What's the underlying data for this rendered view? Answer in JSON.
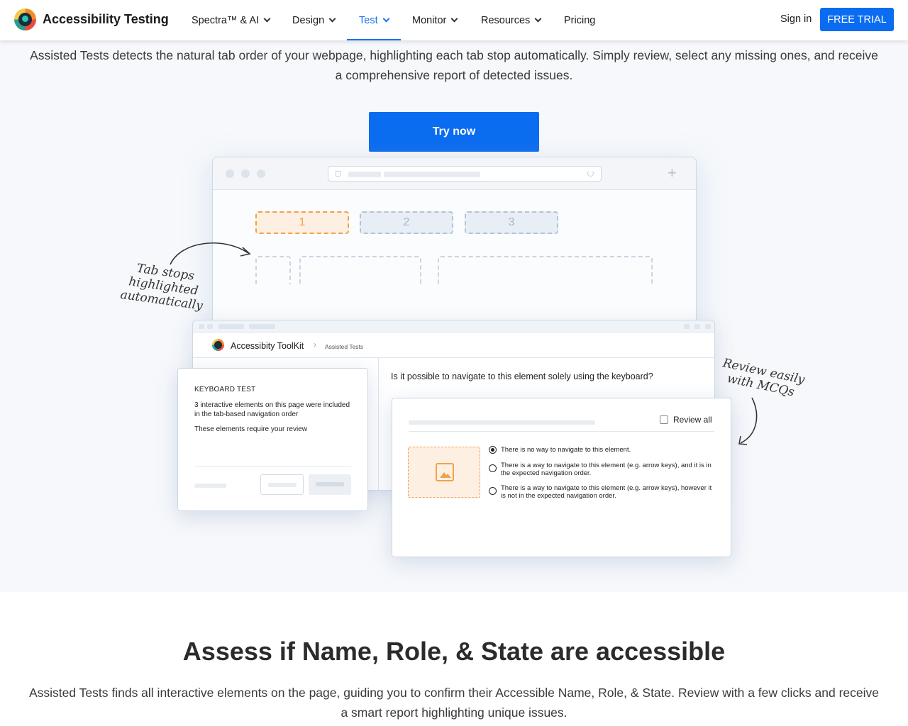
{
  "header": {
    "brand": "Accessibility Testing",
    "nav": [
      {
        "label": "Spectra™ & AI",
        "has_menu": true
      },
      {
        "label": "Design",
        "has_menu": true
      },
      {
        "label": "Test",
        "has_menu": true,
        "active": true
      },
      {
        "label": "Monitor",
        "has_menu": true
      },
      {
        "label": "Resources",
        "has_menu": true
      },
      {
        "label": "Pricing",
        "has_menu": false
      }
    ],
    "signin": "Sign in",
    "cta": "FREE TRIAL"
  },
  "hero": {
    "description": "Assisted Tests detects the natural tab order of your webpage, highlighting each tab stop automatically. Simply review, select any missing ones, and receive a comprehensive report of detected issues.",
    "button": "Try now"
  },
  "illustration": {
    "tab_stops": [
      "1",
      "2",
      "3"
    ],
    "note_left": "Tab stops highlighted automatically",
    "note_right": "Review easily with MCQs",
    "toolkit": {
      "name": "Accessibity ToolKit",
      "breadcrumb": "Assisted Tests",
      "question": "Is it possible to navigate to this element solely using the keyboard?"
    },
    "keyboard_card": {
      "title": "KEYBOARD TEST",
      "text": "3 interactive elements on this page were included in the tab-based navigation order",
      "subtext": "These elements require your review"
    },
    "mcq": {
      "review_all": "Review all",
      "options": [
        {
          "text": "There is no way to navigate to this element.",
          "selected": true
        },
        {
          "text": "There is a way to navigate to this element (e.g. arrow keys), and it is in the expected navigation order.",
          "selected": false
        },
        {
          "text": "There is a way to navigate to this element (e.g. arrow keys), however it is not in the expected navigation order.",
          "selected": false
        }
      ]
    }
  },
  "section2": {
    "title": "Assess if Name, Role, & State are accessible",
    "description": "Assisted Tests finds all interactive elements on the page, guiding you to confirm their Accessible Name, Role, & State. Review with a few clicks and receive a smart report highlighting unique issues."
  },
  "colors": {
    "primary": "#0a6cf0",
    "accent_orange": "#f0a24a",
    "hero_bg": "#f6f8fb"
  }
}
